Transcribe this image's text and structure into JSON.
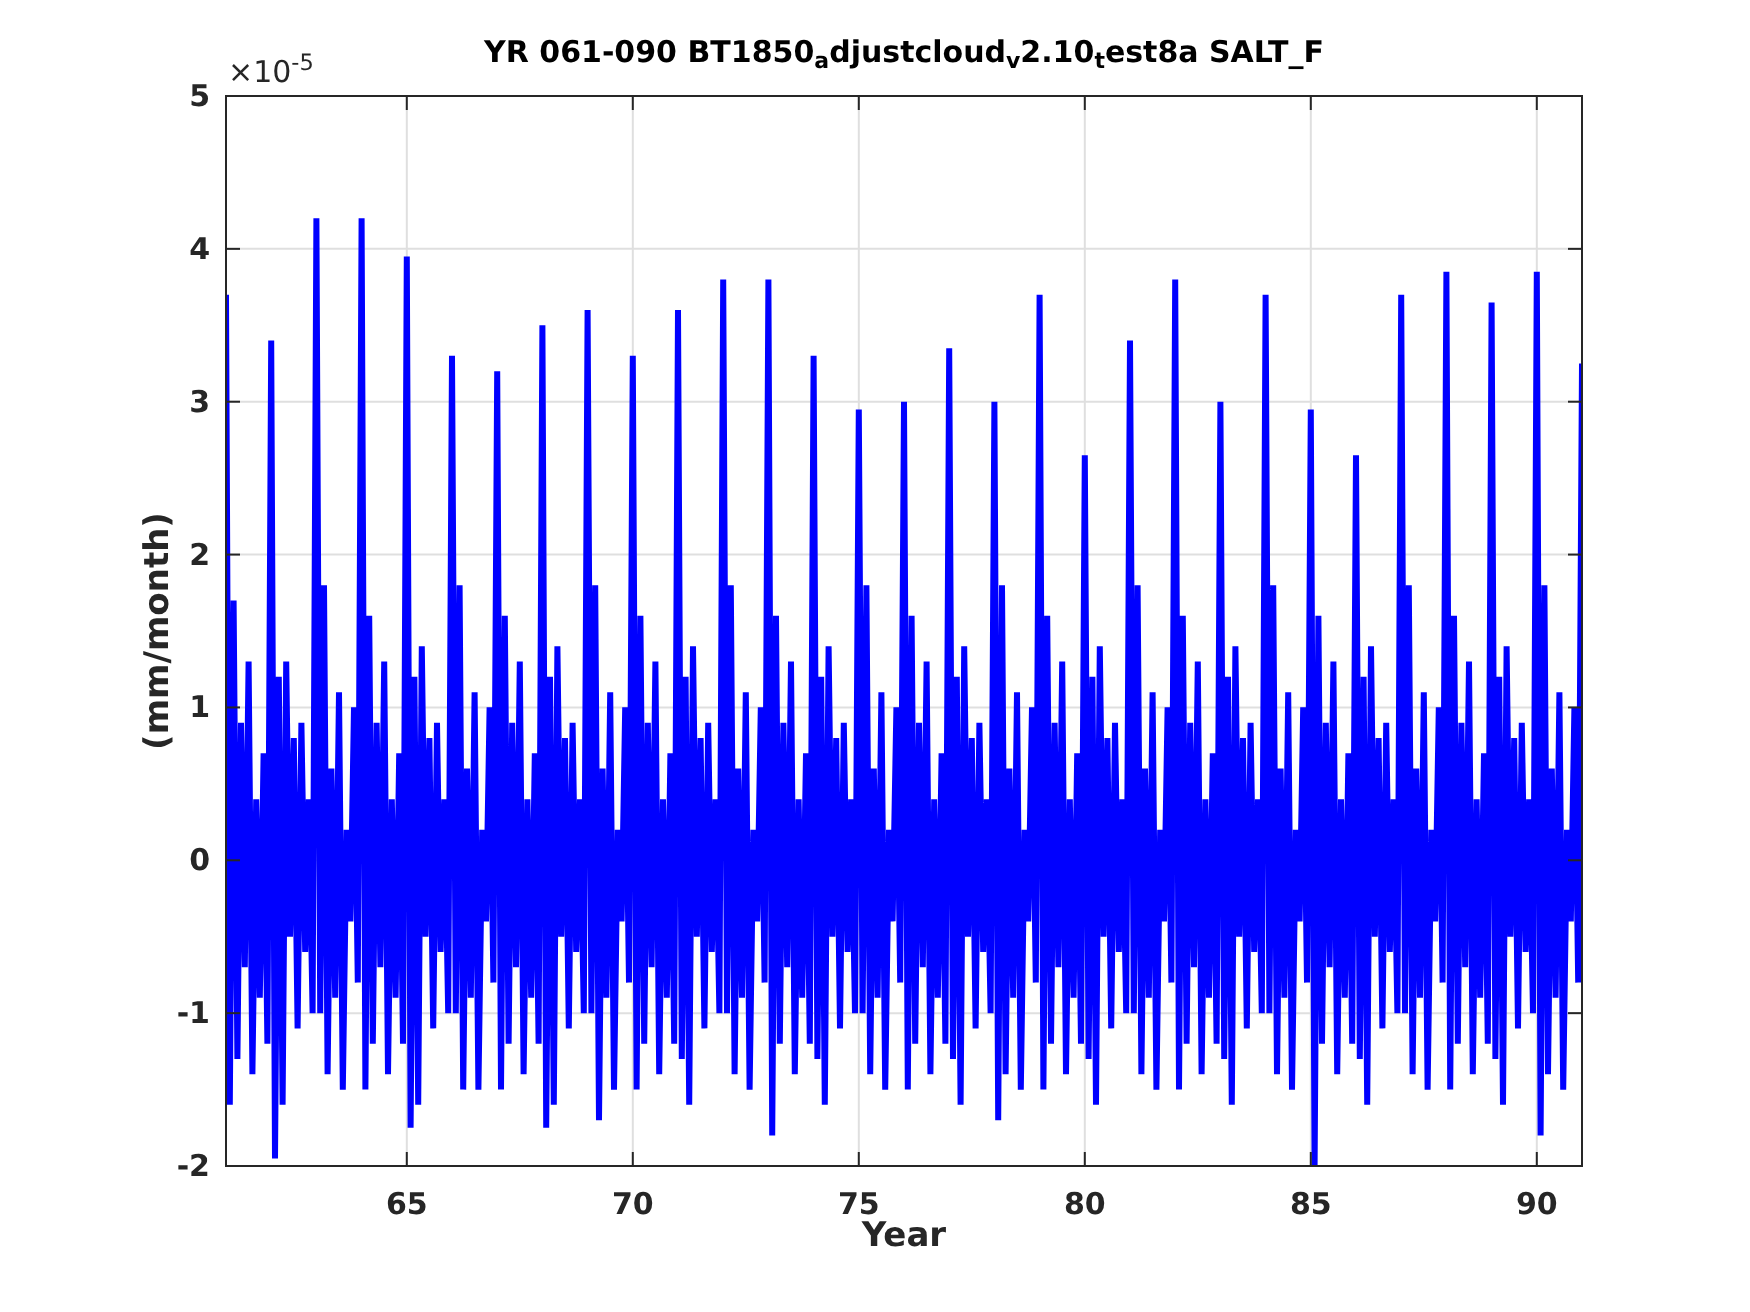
{
  "figure": {
    "chart_data": {
      "type": "line",
      "grid": true,
      "title": "YR 061-090 BT1850$_{a}$djustcloud$_{v}$2.10$_{t}$est8a SALT_F",
      "xlabel": "Year",
      "ylabel": "(mm/month)",
      "xlim": [
        61,
        91
      ],
      "ylim": [
        -2,
        5
      ],
      "xticks": [
        65,
        70,
        75,
        80,
        85,
        90
      ],
      "yticks": [
        -2,
        -1,
        0,
        1,
        2,
        3,
        4,
        5
      ],
      "annotations": [
        "×10$^{-5}$"
      ],
      "x": [
        61,
        61.083,
        61.167,
        61.25,
        61.333,
        61.417,
        61.5,
        61.583,
        61.667,
        61.75,
        61.833,
        61.917,
        62,
        62.083,
        62.167,
        62.25,
        62.333,
        62.417,
        62.5,
        62.583,
        62.667,
        62.75,
        62.833,
        62.917,
        63,
        63.083,
        63.167,
        63.25,
        63.333,
        63.417,
        63.5,
        63.583,
        63.667,
        63.75,
        63.833,
        63.917,
        64,
        64.083,
        64.167,
        64.25,
        64.333,
        64.417,
        64.5,
        64.583,
        64.667,
        64.75,
        64.833,
        64.917,
        65,
        65.083,
        65.167,
        65.25,
        65.333,
        65.417,
        65.5,
        65.583,
        65.667,
        65.75,
        65.833,
        65.917,
        66,
        66.083,
        66.167,
        66.25,
        66.333,
        66.417,
        66.5,
        66.583,
        66.667,
        66.75,
        66.833,
        66.917,
        67,
        67.083,
        67.167,
        67.25,
        67.333,
        67.417,
        67.5,
        67.583,
        67.667,
        67.75,
        67.833,
        67.917,
        68,
        68.083,
        68.167,
        68.25,
        68.333,
        68.417,
        68.5,
        68.583,
        68.667,
        68.75,
        68.833,
        68.917,
        69,
        69.083,
        69.167,
        69.25,
        69.333,
        69.417,
        69.5,
        69.583,
        69.667,
        69.75,
        69.833,
        69.917,
        70,
        70.083,
        70.167,
        70.25,
        70.333,
        70.417,
        70.5,
        70.583,
        70.667,
        70.75,
        70.833,
        70.917,
        71,
        71.083,
        71.167,
        71.25,
        71.333,
        71.417,
        71.5,
        71.583,
        71.667,
        71.75,
        71.833,
        71.917,
        72,
        72.083,
        72.167,
        72.25,
        72.333,
        72.417,
        72.5,
        72.583,
        72.667,
        72.75,
        72.833,
        72.917,
        73,
        73.083,
        73.167,
        73.25,
        73.333,
        73.417,
        73.5,
        73.583,
        73.667,
        73.75,
        73.833,
        73.917,
        74,
        74.083,
        74.167,
        74.25,
        74.333,
        74.417,
        74.5,
        74.583,
        74.667,
        74.75,
        74.833,
        74.917,
        75,
        75.083,
        75.167,
        75.25,
        75.333,
        75.417,
        75.5,
        75.583,
        75.667,
        75.75,
        75.833,
        75.917,
        76,
        76.083,
        76.167,
        76.25,
        76.333,
        76.417,
        76.5,
        76.583,
        76.667,
        76.75,
        76.833,
        76.917,
        77,
        77.083,
        77.167,
        77.25,
        77.333,
        77.417,
        77.5,
        77.583,
        77.667,
        77.75,
        77.833,
        77.917,
        78,
        78.083,
        78.167,
        78.25,
        78.333,
        78.417,
        78.5,
        78.583,
        78.667,
        78.75,
        78.833,
        78.917,
        79,
        79.083,
        79.167,
        79.25,
        79.333,
        79.417,
        79.5,
        79.583,
        79.667,
        79.75,
        79.833,
        79.917,
        80,
        80.083,
        80.167,
        80.25,
        80.333,
        80.417,
        80.5,
        80.583,
        80.667,
        80.75,
        80.833,
        80.917,
        81,
        81.083,
        81.167,
        81.25,
        81.333,
        81.417,
        81.5,
        81.583,
        81.667,
        81.75,
        81.833,
        81.917,
        82,
        82.083,
        82.167,
        82.25,
        82.333,
        82.417,
        82.5,
        82.583,
        82.667,
        82.75,
        82.833,
        82.917,
        83,
        83.083,
        83.167,
        83.25,
        83.333,
        83.417,
        83.5,
        83.583,
        83.667,
        83.75,
        83.833,
        83.917,
        84,
        84.083,
        84.167,
        84.25,
        84.333,
        84.417,
        84.5,
        84.583,
        84.667,
        84.75,
        84.833,
        84.917,
        85,
        85.083,
        85.167,
        85.25,
        85.333,
        85.417,
        85.5,
        85.583,
        85.667,
        85.75,
        85.833,
        85.917,
        86,
        86.083,
        86.167,
        86.25,
        86.333,
        86.417,
        86.5,
        86.583,
        86.667,
        86.75,
        86.833,
        86.917,
        87,
        87.083,
        87.167,
        87.25,
        87.333,
        87.417,
        87.5,
        87.583,
        87.667,
        87.75,
        87.833,
        87.917,
        88,
        88.083,
        88.167,
        88.25,
        88.333,
        88.417,
        88.5,
        88.583,
        88.667,
        88.75,
        88.833,
        88.917,
        89,
        89.083,
        89.167,
        89.25,
        89.333,
        89.417,
        89.5,
        89.583,
        89.667,
        89.75,
        89.833,
        89.917,
        90,
        90.083,
        90.167,
        90.25,
        90.333,
        90.417,
        90.5,
        90.583,
        90.667,
        90.75,
        90.833,
        90.917,
        91
      ],
      "series": [
        {
          "color": "#0000ff",
          "values": [
            3.7,
            -1.6,
            1.7,
            -1.3,
            0.9,
            -0.7,
            1.3,
            -1.4,
            0.4,
            -0.9,
            0.7,
            -1.2,
            3.4,
            -1.95,
            1.2,
            -1.6,
            1.3,
            -0.5,
            0.8,
            -1.1,
            0.9,
            -0.6,
            0.4,
            -1.0,
            4.2,
            -1.0,
            1.8,
            -1.4,
            0.6,
            -0.9,
            1.1,
            -1.5,
            0.2,
            -0.4,
            1.0,
            -0.8,
            4.2,
            -1.5,
            1.6,
            -1.2,
            0.9,
            -0.7,
            1.3,
            -1.4,
            0.4,
            -0.9,
            0.7,
            -1.2,
            3.95,
            -1.75,
            1.2,
            -1.6,
            1.4,
            -0.5,
            0.8,
            -1.1,
            0.9,
            -0.6,
            0.4,
            -1.0,
            3.3,
            -1.0,
            1.8,
            -1.5,
            0.6,
            -0.9,
            1.1,
            -1.5,
            0.2,
            -0.4,
            1.0,
            -0.8,
            3.2,
            -1.5,
            1.6,
            -1.2,
            0.9,
            -0.7,
            1.3,
            -1.4,
            0.4,
            -0.9,
            0.7,
            -1.2,
            3.5,
            -1.75,
            1.2,
            -1.6,
            1.4,
            -0.5,
            0.8,
            -1.1,
            0.9,
            -0.6,
            0.4,
            -1.0,
            3.6,
            -1.0,
            1.8,
            -1.7,
            0.6,
            -0.9,
            1.1,
            -1.5,
            0.2,
            -0.4,
            1.0,
            -0.8,
            3.3,
            -1.5,
            1.6,
            -1.2,
            0.9,
            -0.7,
            1.3,
            -1.4,
            0.4,
            -0.9,
            0.7,
            -1.2,
            3.6,
            -1.3,
            1.2,
            -1.6,
            1.4,
            -0.5,
            0.8,
            -1.1,
            0.9,
            -0.6,
            0.4,
            -1.0,
            3.8,
            -1.0,
            1.8,
            -1.4,
            0.6,
            -0.9,
            1.1,
            -1.5,
            0.2,
            -0.4,
            1.0,
            -0.8,
            3.8,
            -1.8,
            1.6,
            -1.2,
            0.9,
            -0.7,
            1.3,
            -1.4,
            0.4,
            -0.9,
            0.7,
            -1.2,
            3.3,
            -1.3,
            1.2,
            -1.6,
            1.4,
            -0.5,
            0.8,
            -1.1,
            0.9,
            -0.6,
            0.4,
            -1.0,
            2.95,
            -1.0,
            1.8,
            -1.4,
            0.6,
            -0.9,
            1.1,
            -1.5,
            0.2,
            -0.4,
            1.0,
            -0.8,
            3.0,
            -1.5,
            1.6,
            -1.2,
            0.9,
            -0.7,
            1.3,
            -1.4,
            0.4,
            -0.9,
            0.7,
            -1.2,
            3.35,
            -1.3,
            1.2,
            -1.6,
            1.4,
            -0.5,
            0.8,
            -1.1,
            0.9,
            -0.6,
            0.4,
            -1.0,
            3.0,
            -1.7,
            1.8,
            -1.4,
            0.6,
            -0.9,
            1.1,
            -1.5,
            0.2,
            -0.4,
            1.0,
            -0.8,
            3.7,
            -1.5,
            1.6,
            -1.2,
            0.9,
            -0.7,
            1.3,
            -1.4,
            0.4,
            -0.9,
            0.7,
            -1.2,
            2.65,
            -1.3,
            1.2,
            -1.6,
            1.4,
            -0.5,
            0.8,
            -1.1,
            0.9,
            -0.6,
            0.4,
            -1.0,
            3.4,
            -1.0,
            1.8,
            -1.4,
            0.6,
            -0.9,
            1.1,
            -1.5,
            0.2,
            -0.4,
            1.0,
            -0.8,
            3.8,
            -1.5,
            1.6,
            -1.2,
            0.9,
            -0.7,
            1.3,
            -1.4,
            0.4,
            -0.9,
            0.7,
            -1.2,
            3.0,
            -1.3,
            1.2,
            -1.6,
            1.4,
            -0.5,
            0.8,
            -1.1,
            0.9,
            -0.6,
            0.4,
            -1.0,
            3.7,
            -1.0,
            1.8,
            -1.4,
            0.6,
            -0.9,
            1.1,
            -1.5,
            0.2,
            -0.4,
            1.0,
            -0.8,
            2.95,
            -2.0,
            1.6,
            -1.2,
            0.9,
            -0.7,
            1.3,
            -1.4,
            0.4,
            -0.9,
            0.7,
            -1.2,
            2.65,
            -1.3,
            1.2,
            -1.6,
            1.4,
            -0.5,
            0.8,
            -1.1,
            0.9,
            -0.6,
            0.4,
            -1.0,
            3.7,
            -1.0,
            1.8,
            -1.4,
            0.6,
            -0.9,
            1.1,
            -1.5,
            0.2,
            -0.4,
            1.0,
            -0.8,
            3.85,
            -1.5,
            1.6,
            -1.2,
            0.9,
            -0.7,
            1.3,
            -1.4,
            0.4,
            -0.9,
            0.7,
            -1.2,
            3.65,
            -1.3,
            1.2,
            -1.6,
            1.4,
            -0.5,
            0.8,
            -1.1,
            0.9,
            -0.6,
            0.4,
            -1.0,
            3.85,
            -1.8,
            1.8,
            -1.4,
            0.6,
            -0.9,
            1.1,
            -1.5,
            0.2,
            -0.4,
            1.0,
            -0.8,
            3.25
          ]
        }
      ]
    }
  }
}
